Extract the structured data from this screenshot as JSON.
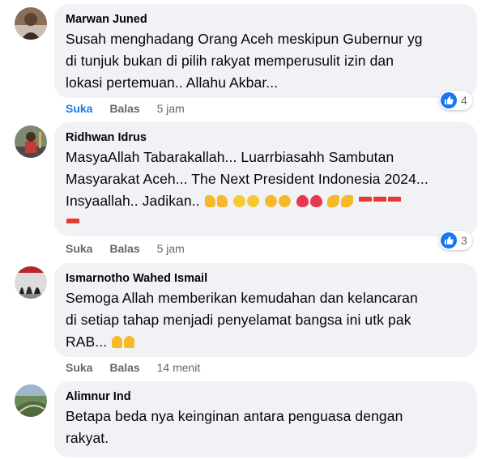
{
  "comments": [
    {
      "author": "Marwan Juned",
      "lines": [
        "Susah menghadang Orang Aceh meskipun Gubernur yg",
        "di tunjuk bukan di pilih rakyat memperusulit izin dan",
        "lokasi pertemuan.. Allahu Akbar..."
      ],
      "like_label": "Suka",
      "reply_label": "Balas",
      "time": "5 jam",
      "reaction_count": "4",
      "liked": true
    },
    {
      "author": "Ridhwan Idrus",
      "lines": [
        "MasyaAllah Tabarakallah... Luarrbiasahh Sambutan",
        "Masyarakat Aceh... The Next President Indonesia 2024...",
        "Insyaallah.. Jadikan.."
      ],
      "like_label": "Suka",
      "reply_label": "Balas",
      "time": "5 jam",
      "reaction_count": "3",
      "liked": false
    },
    {
      "author": "Ismarnotho Wahed Ismail",
      "lines": [
        "Semoga Allah memberikan kemudahan dan kelancaran",
        "di setiap tahap menjadi penyelamat bangsa ini utk pak",
        "RAB..."
      ],
      "like_label": "Suka",
      "reply_label": "Balas",
      "time": "14 menit",
      "liked": false
    },
    {
      "author": "Alimnur Ind",
      "lines": [
        "Betapa beda nya keinginan antara penguasa dengan",
        "rakyat."
      ]
    }
  ],
  "colors": {
    "like_blue": "#1877f2",
    "bubble": "#f0f2f5",
    "meta": "#65676b"
  },
  "icons": [
    "like-icon",
    "thumbs-up-emoji",
    "grinning-emoji",
    "kiss-emoji",
    "heart-emoji",
    "flexed-arm-emoji",
    "indonesia-flag-emoji",
    "praying-hands-emoji"
  ]
}
